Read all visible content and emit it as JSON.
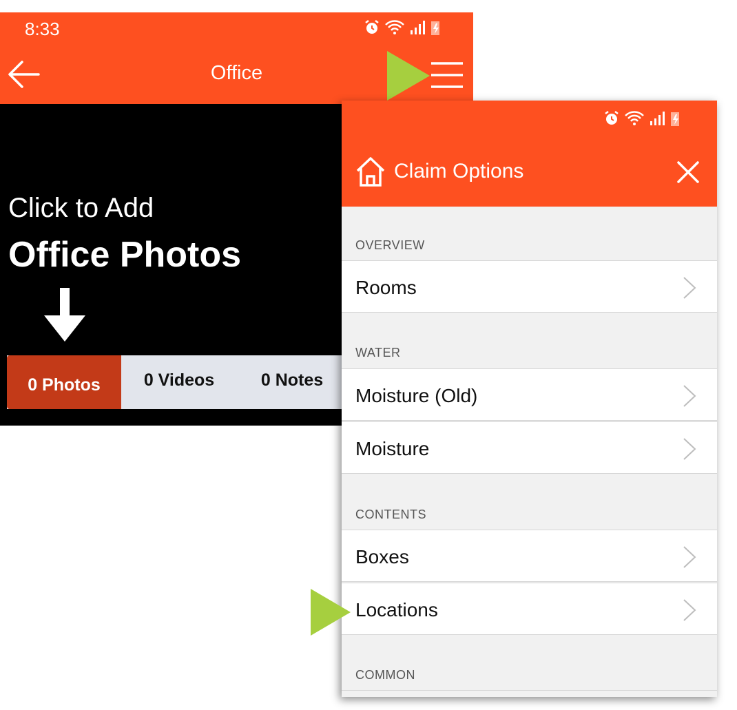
{
  "statusbar": {
    "time": "8:33"
  },
  "toolbar": {
    "title": "Office"
  },
  "empty_state": {
    "line1": "Click to Add",
    "line2": "Office Photos"
  },
  "tabs": [
    {
      "label": "0 Photos",
      "active": true
    },
    {
      "label": "0 Videos",
      "active": false
    },
    {
      "label": "0 Notes",
      "active": false
    }
  ],
  "panel": {
    "title": "Claim Options",
    "sections": [
      {
        "label": "OVERVIEW",
        "items": [
          "Rooms"
        ]
      },
      {
        "label": "WATER",
        "items": [
          "Moisture (Old)",
          "Moisture"
        ]
      },
      {
        "label": "CONTENTS",
        "items": [
          "Boxes",
          "Locations"
        ]
      },
      {
        "label": "COMMON",
        "items": []
      }
    ]
  },
  "colors": {
    "brand": "#fe5020",
    "active_tab": "#c33a18",
    "pointer": "#a6cf3f"
  }
}
